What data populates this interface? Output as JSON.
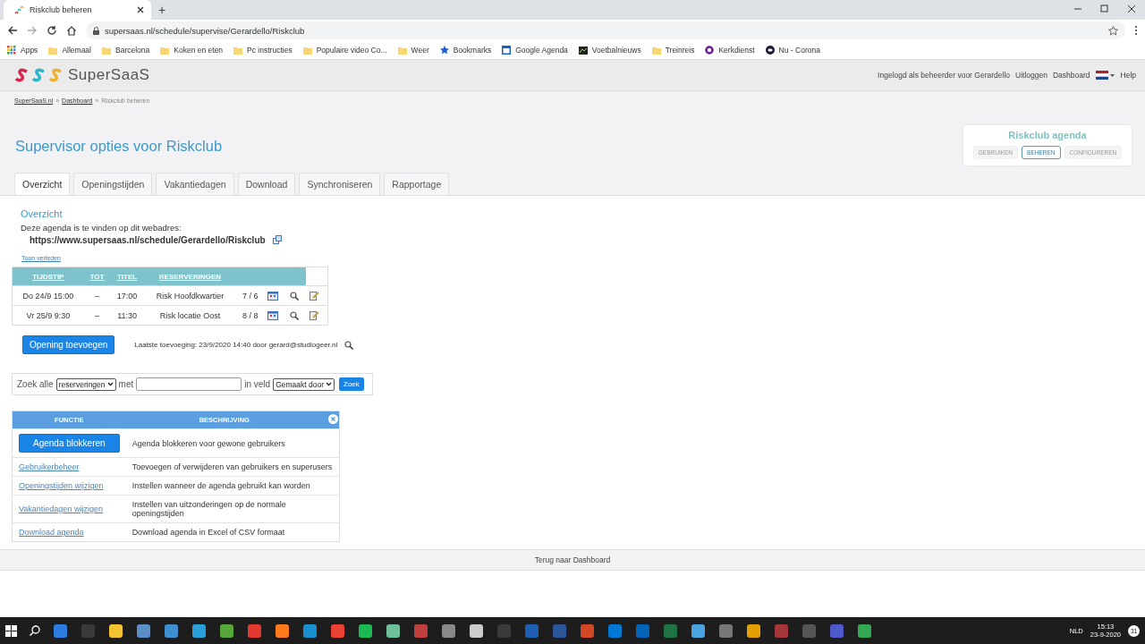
{
  "browser": {
    "tab_title": "Riskclub beheren",
    "new_tab": "+",
    "url": "supersaas.nl/schedule/supervise/Gerardello/Riskclub",
    "bookmarks": [
      {
        "kind": "apps",
        "label": "Apps"
      },
      {
        "kind": "folder",
        "label": "Allemaal"
      },
      {
        "kind": "folder",
        "label": "Barcelona"
      },
      {
        "kind": "folder",
        "label": "Koken en eten"
      },
      {
        "kind": "folder",
        "label": "Pc instructies"
      },
      {
        "kind": "folder",
        "label": "Populaire video Co..."
      },
      {
        "kind": "folder",
        "label": "Weer"
      },
      {
        "kind": "star",
        "label": "Bookmarks"
      },
      {
        "kind": "calendar",
        "label": "Google Agenda"
      },
      {
        "kind": "site",
        "label": "Voetbalnieuws"
      },
      {
        "kind": "folder",
        "label": "Treinreis"
      },
      {
        "kind": "ring",
        "label": "Kerkdienst"
      },
      {
        "kind": "dot",
        "label": "Nu - Corona"
      }
    ]
  },
  "header": {
    "logo_text": "SuperSaaS",
    "user_info": "Ingelogd als beheerder voor Gerardello",
    "links": [
      "Uitloggen",
      "Dashboard"
    ],
    "help": "Help"
  },
  "breadcrumb": {
    "items": [
      {
        "label": "SuperSaaS.nl",
        "link": true
      },
      {
        "label": "Dashboard",
        "link": true
      },
      {
        "label": "Riskclub beheren",
        "link": false
      }
    ],
    "separator": "»"
  },
  "title": "Supervisor opties voor Riskclub",
  "agenda_card": {
    "title": "Riskclub agenda",
    "buttons": [
      {
        "label": "GEBRUIKEN",
        "selected": false
      },
      {
        "label": "BEHEREN",
        "selected": true
      },
      {
        "label": "CONFIGUREREN",
        "selected": false
      }
    ]
  },
  "tabs": [
    {
      "label": "Overzicht",
      "selected": true
    },
    {
      "label": "Openingstijden",
      "selected": false
    },
    {
      "label": "Vakantiedagen",
      "selected": false
    },
    {
      "label": "Download",
      "selected": false
    },
    {
      "label": "Synchroniseren",
      "selected": false
    },
    {
      "label": "Rapportage",
      "selected": false
    }
  ],
  "overview": {
    "heading": "Overzicht",
    "intro": "Deze agenda is te vinden op dit webadres:",
    "url": "https://www.supersaas.nl/schedule/Gerardello/Riskclub",
    "show_past": "Toon verleden"
  },
  "schedule_table": {
    "columns": [
      "TIJDSTIP",
      "TOT",
      "TITEL",
      "RESERVERINGEN"
    ],
    "rows": [
      {
        "start": "Do 24/9 15:00",
        "dash": "–",
        "end": "17:00",
        "title": "Risk Hoofdkwartier",
        "reservations": "7 / 6"
      },
      {
        "start": "Vr 25/9 9:30",
        "dash": "–",
        "end": "11:30",
        "title": "Risk locatie Oost",
        "reservations": "8 / 8"
      }
    ]
  },
  "add_button": "Opening toevoegen",
  "last_added": "Laatste toevoeging: 23/9/2020 14:40 door gerard@studiogeer.nl",
  "search": {
    "label_all": "Zoek alle",
    "type_select": "reserveringen",
    "label_with": "met",
    "label_field": "in veld",
    "field_select": "Gemaakt door",
    "button": "Zoek"
  },
  "functions_table": {
    "columns": [
      "FUNCTIE",
      "BESCHRIJVING"
    ],
    "rows": [
      {
        "kind": "button",
        "label": "Agenda blokkeren",
        "description": "Agenda blokkeren voor gewone gebruikers"
      },
      {
        "kind": "link",
        "label": "Gebruikerbeheer",
        "description": "Toevoegen of verwijderen van gebruikers en superusers"
      },
      {
        "kind": "link",
        "label": "Openingstijden wijzigen",
        "description": "Instellen wanneer de agenda gebruikt kan worden"
      },
      {
        "kind": "link",
        "label": "Vakantiedagen wijzigen",
        "description": "Instellen van uitzonderingen op de normale openingstijden"
      },
      {
        "kind": "link",
        "label": "Download agenda",
        "description": "Download agenda in Excel of CSV formaat"
      }
    ]
  },
  "footer": "Terug naar Dashboard",
  "taskbar": {
    "language": "NLD",
    "time": "15:13",
    "date": "23-9-2020",
    "notifications": "31"
  }
}
